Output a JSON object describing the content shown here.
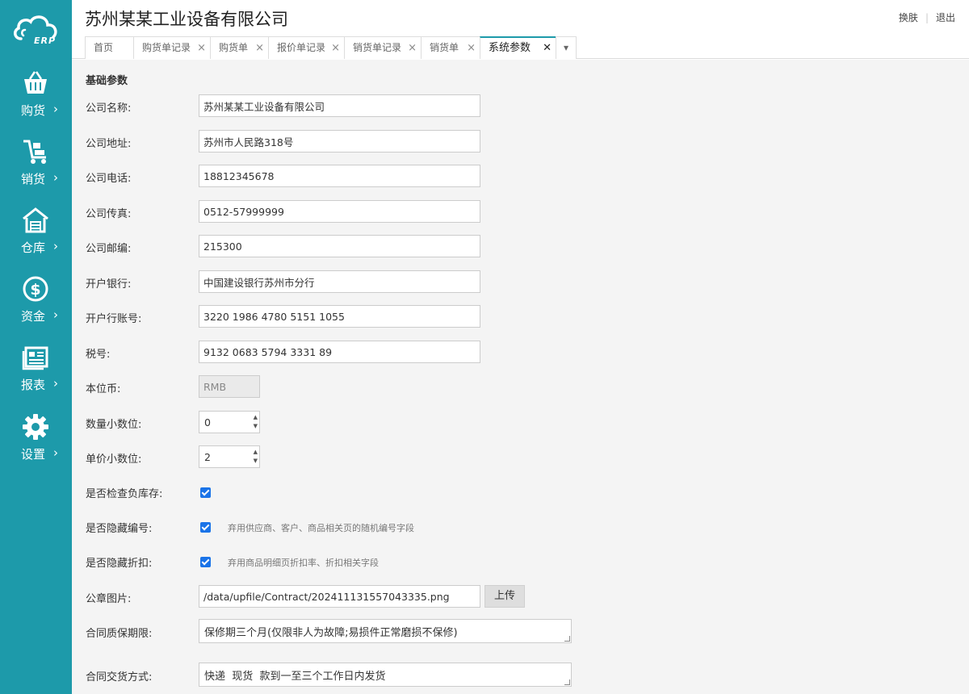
{
  "app": {
    "logo_text": "ERP",
    "company_title": "苏州某某工业设备有限公司",
    "top_links": {
      "skin": "换肤",
      "logout": "退出"
    }
  },
  "sidebar": {
    "items": [
      {
        "label": "购货",
        "icon": "basket-icon"
      },
      {
        "label": "销货",
        "icon": "cart-icon"
      },
      {
        "label": "仓库",
        "icon": "warehouse-icon"
      },
      {
        "label": "资金",
        "icon": "dollar-icon"
      },
      {
        "label": "报表",
        "icon": "report-icon"
      },
      {
        "label": "设置",
        "icon": "gear-icon"
      }
    ],
    "arrow": "›"
  },
  "tabs": [
    {
      "label": "首页"
    },
    {
      "label": "购货单记录"
    },
    {
      "label": "购货单"
    },
    {
      "label": "报价单记录"
    },
    {
      "label": "销货单记录"
    },
    {
      "label": "销货单"
    },
    {
      "label": "系统参数",
      "active": true
    }
  ],
  "tab_close": "×",
  "tab_active_close": "✕",
  "tab_dropdown": "▾",
  "section_title": "基础参数",
  "form": {
    "company_name": {
      "label": "公司名称:",
      "value": "苏州某某工业设备有限公司"
    },
    "company_address": {
      "label": "公司地址:",
      "value": "苏州市人民路318号"
    },
    "company_phone": {
      "label": "公司电话:",
      "value": "18812345678"
    },
    "company_fax": {
      "label": "公司传真:",
      "value": "0512-57999999"
    },
    "company_zip": {
      "label": "公司邮编:",
      "value": "215300"
    },
    "bank": {
      "label": "开户银行:",
      "value": "中国建设银行苏州市分行"
    },
    "bank_account": {
      "label": "开户行账号:",
      "value": "3220 1986 4780 5151 1055"
    },
    "tax_id": {
      "label": "税号:",
      "value": "9132 0683 5794 3331 89"
    },
    "currency": {
      "label": "本位币:",
      "value": "RMB"
    },
    "qty_decimals": {
      "label": "数量小数位:",
      "value": "0"
    },
    "price_decimals": {
      "label": "单价小数位:",
      "value": "2"
    },
    "check_negative_stock": {
      "label": "是否检查负库存:",
      "checked": true
    },
    "hide_code": {
      "label": "是否隐藏编号:",
      "checked": true,
      "hint": "弃用供应商、客户、商品相关页的随机编号字段"
    },
    "hide_discount": {
      "label": "是否隐藏折扣:",
      "checked": true,
      "hint": "弃用商品明细页折扣率、折扣相关字段"
    },
    "seal_image": {
      "label": "公章图片:",
      "value": "/data/upfile/Contract/202411131557043335.png",
      "button": "上传"
    },
    "warranty": {
      "label": "合同质保期限:",
      "value": "保修期三个月(仅限非人为故障;易损件正常磨损不保修)"
    },
    "delivery": {
      "label": "合同交货方式:",
      "value": "快递  现货  款到一至三个工作日内发货"
    }
  },
  "colors": {
    "sidebar": "#1d9aaa",
    "accent": "#1a73e8"
  }
}
